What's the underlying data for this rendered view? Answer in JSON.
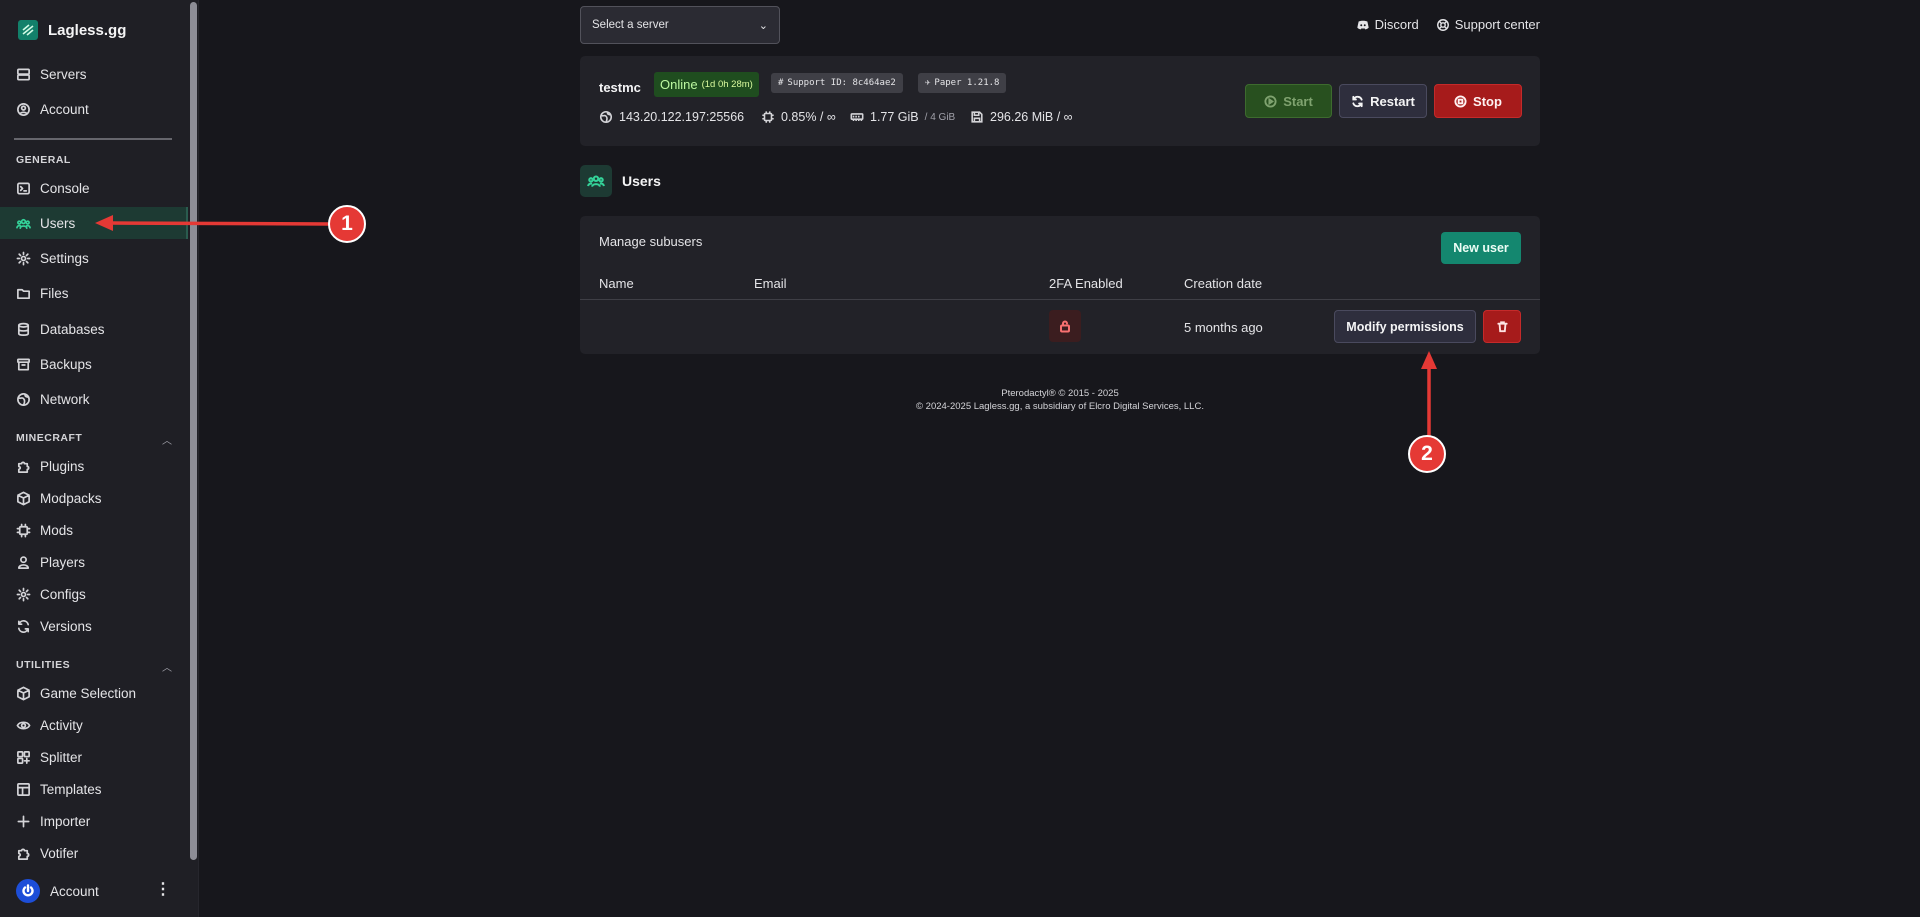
{
  "brand": {
    "name": "Lagless.gg"
  },
  "sidebar": {
    "top_items": [
      {
        "label": "Servers",
        "icon": "servers-icon"
      },
      {
        "label": "Account",
        "icon": "account-circle-icon"
      }
    ],
    "sections": {
      "general": "GENERAL",
      "minecraft": "MINECRAFT",
      "utilities": "UTILITIES"
    },
    "general_items": [
      {
        "label": "Console"
      },
      {
        "label": "Users",
        "active": true
      },
      {
        "label": "Settings"
      },
      {
        "label": "Files"
      },
      {
        "label": "Databases"
      },
      {
        "label": "Backups"
      },
      {
        "label": "Network"
      }
    ],
    "minecraft_items": [
      {
        "label": "Plugins"
      },
      {
        "label": "Modpacks"
      },
      {
        "label": "Mods"
      },
      {
        "label": "Players"
      },
      {
        "label": "Configs"
      },
      {
        "label": "Versions"
      }
    ],
    "utilities_items": [
      {
        "label": "Game Selection"
      },
      {
        "label": "Activity"
      },
      {
        "label": "Splitter"
      },
      {
        "label": "Templates"
      },
      {
        "label": "Importer"
      },
      {
        "label": "Votifer"
      }
    ],
    "account_label": "Account"
  },
  "header": {
    "server_select_placeholder": "Select a server",
    "discord_label": "Discord",
    "support_label": "Support center"
  },
  "server": {
    "name": "testmc",
    "status": "Online",
    "uptime": "(1d 0h 28m)",
    "support_id": "Support ID: 8c464ae2",
    "software": "Paper 1.21.8",
    "address": "143.20.122.197:25566",
    "cpu": "0.85% / ∞",
    "memory": "1.77 GiB",
    "memory_limit": "/ 4 GiB",
    "disk": "296.26 MiB / ∞",
    "start_label": "Start",
    "restart_label": "Restart",
    "stop_label": "Stop"
  },
  "users_page": {
    "title": "Users",
    "manage_label": "Manage subusers",
    "new_user_label": "New user",
    "columns": [
      "Name",
      "Email",
      "2FA Enabled",
      "Creation date"
    ],
    "rows": [
      {
        "name": "",
        "email": "",
        "twofa": false,
        "created": "5 months ago"
      }
    ],
    "modify_label": "Modify permissions"
  },
  "footer": {
    "line1": "Pterodactyl® © 2015 - 2025",
    "line2": "© 2024-2025 Lagless.gg, a subsidiary of Elcro Digital Services, LLC."
  },
  "annotations": {
    "marker1": "1",
    "marker2": "2",
    "color": "#e53935"
  }
}
